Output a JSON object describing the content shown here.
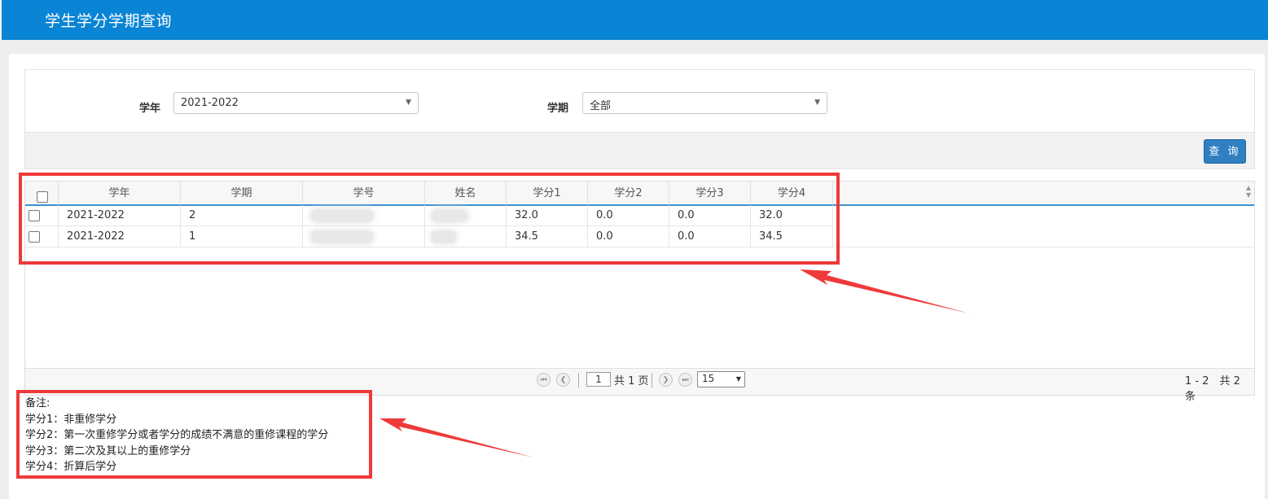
{
  "app": {
    "title": "学生学分学期查询"
  },
  "filters": {
    "year_label": "学年",
    "year_value": "2021-2022",
    "term_label": "学期",
    "term_value": "全部",
    "query_button": "查 询"
  },
  "table": {
    "columns": [
      "学年",
      "学期",
      "学号",
      "姓名",
      "学分1",
      "学分2",
      "学分3",
      "学分4"
    ],
    "rows": [
      {
        "year": "2021-2022",
        "term": "2",
        "credit1": "32.0",
        "credit2": "0.0",
        "credit3": "0.0",
        "credit4": "32.0"
      },
      {
        "year": "2021-2022",
        "term": "1",
        "credit1": "34.5",
        "credit2": "0.0",
        "credit3": "0.0",
        "credit4": "34.5"
      }
    ]
  },
  "pager": {
    "current_page": "1",
    "total_pages_text": "共 1 页",
    "page_size": "15",
    "summary": "1 - 2　共 2 条"
  },
  "notes": {
    "title": "备注:",
    "lines": [
      "学分1：非重修学分",
      "学分2：第一次重修学分或者学分的成绩不满意的重修课程的学分",
      "学分3：第二次及其以上的重修学分",
      "学分4：折算后学分"
    ]
  },
  "colors": {
    "header_bar": "#0a84d4",
    "query_button": "#2f7fc1",
    "annotation_red": "#ee3a3a"
  }
}
